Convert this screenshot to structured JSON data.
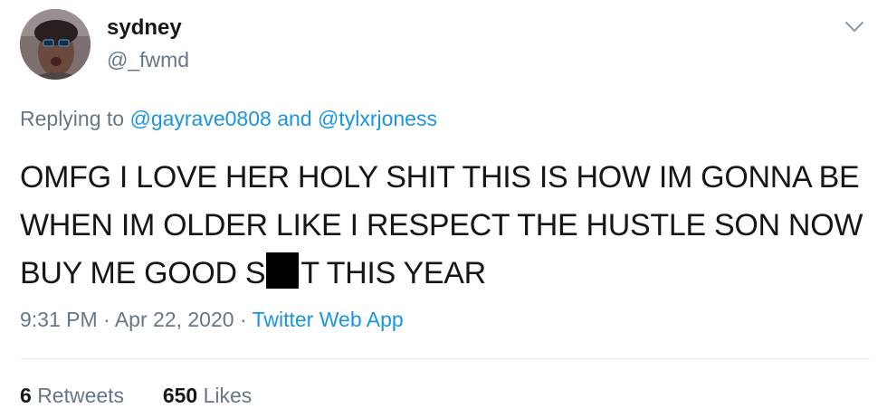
{
  "user": {
    "display_name": "sydney",
    "handle": "@_fwmd"
  },
  "reply": {
    "prefix": "Replying to",
    "mention_1": "@gayrave0808",
    "joiner": "and",
    "mention_2": "@tylxrjoness"
  },
  "tweet": {
    "text_before": "OMFG I LOVE HER HOLY SHIT THIS IS HOW IM GONNA BE WHEN IM OLDER LIKE I RESPECT THE HUSTLE SON NOW BUY ME GOOD S",
    "text_after": "T THIS YEAR"
  },
  "meta": {
    "time": "9:31 PM",
    "sep1": "·",
    "date": "Apr 22, 2020",
    "sep2": "·",
    "source": "Twitter Web App"
  },
  "stats": {
    "retweets_count": "6",
    "retweets_label": "Retweets",
    "likes_count": "650",
    "likes_label": "Likes"
  },
  "icons": {
    "more": "chevron-down-icon"
  }
}
